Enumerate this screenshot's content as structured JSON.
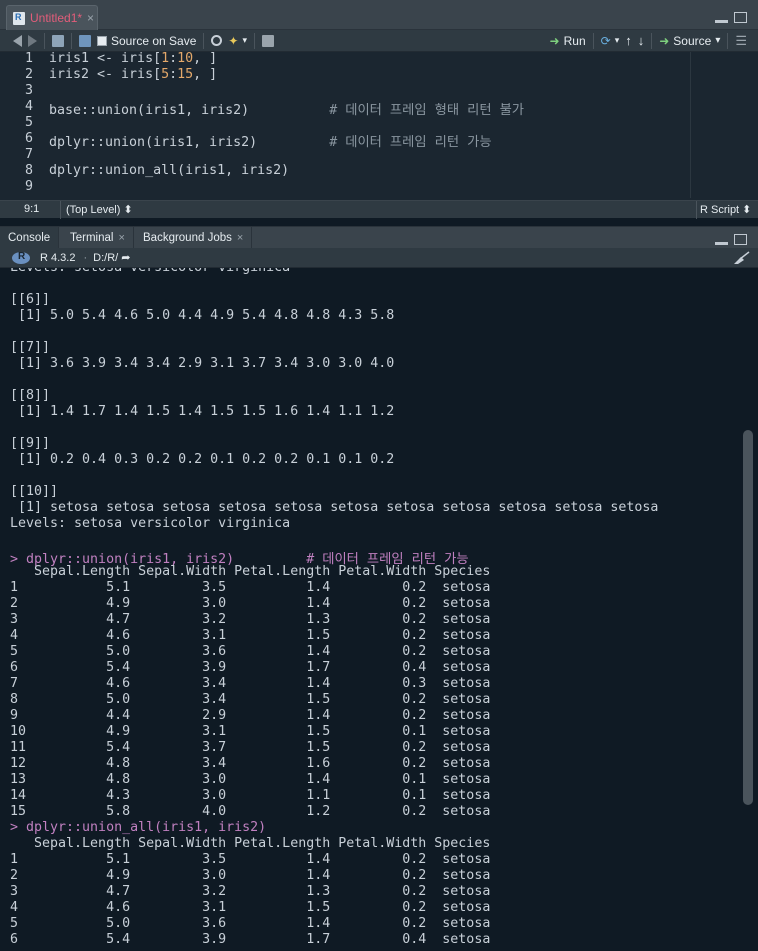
{
  "editor": {
    "tab_label": "Untitled1*",
    "tab_close": "×",
    "toolbar": {
      "source_on_save": "Source on Save",
      "run": "Run",
      "source": "Source",
      "source_menu": "▾"
    },
    "lines": [
      {
        "num": "1",
        "parts": [
          {
            "t": "iris1 <- iris[",
            "c": ""
          },
          {
            "t": "1",
            "c": "num"
          },
          {
            "t": ":",
            "c": ""
          },
          {
            "t": "10",
            "c": "num"
          },
          {
            "t": ", ]",
            "c": ""
          }
        ]
      },
      {
        "num": "2",
        "parts": [
          {
            "t": "iris2 <- iris[",
            "c": ""
          },
          {
            "t": "5",
            "c": "num"
          },
          {
            "t": ":",
            "c": ""
          },
          {
            "t": "15",
            "c": "num"
          },
          {
            "t": ", ]",
            "c": ""
          }
        ]
      },
      {
        "num": "3",
        "parts": []
      },
      {
        "num": "4",
        "parts": [
          {
            "t": "base::union(iris1, iris2)          ",
            "c": ""
          },
          {
            "t": "# 데이터 프레임 형태 리턴 불가",
            "c": "com"
          }
        ]
      },
      {
        "num": "5",
        "parts": []
      },
      {
        "num": "6",
        "parts": [
          {
            "t": "dplyr::union(iris1, iris2)         ",
            "c": ""
          },
          {
            "t": "# 데이터 프레임 리턴 가능",
            "c": "com"
          }
        ]
      },
      {
        "num": "7",
        "parts": []
      },
      {
        "num": "8",
        "parts": [
          {
            "t": "dplyr::union_all(iris1, iris2)",
            "c": ""
          }
        ]
      },
      {
        "num": "9",
        "parts": []
      }
    ],
    "status": {
      "position": "9:1",
      "scope": "(Top Level) ⬍",
      "file_type": "R Script ⬍"
    }
  },
  "console": {
    "tabs": [
      "Console",
      "Terminal",
      "Background Jobs"
    ],
    "tab_close": "×",
    "r_version": "R 4.3.2",
    "working_dir": "D:/R/ ➦",
    "lines": [
      {
        "t": "Levels: setosa versicolor virginica",
        "k": "out"
      },
      {
        "t": "",
        "k": "out"
      },
      {
        "t": "[[6]]",
        "k": "out"
      },
      {
        "t": " [1] 5.0 5.4 4.6 5.0 4.4 4.9 5.4 4.8 4.8 4.3 5.8",
        "k": "out"
      },
      {
        "t": "",
        "k": "out"
      },
      {
        "t": "[[7]]",
        "k": "out"
      },
      {
        "t": " [1] 3.6 3.9 3.4 3.4 2.9 3.1 3.7 3.4 3.0 3.0 4.0",
        "k": "out"
      },
      {
        "t": "",
        "k": "out"
      },
      {
        "t": "[[8]]",
        "k": "out"
      },
      {
        "t": " [1] 1.4 1.7 1.4 1.5 1.4 1.5 1.5 1.6 1.4 1.1 1.2",
        "k": "out"
      },
      {
        "t": "",
        "k": "out"
      },
      {
        "t": "[[9]]",
        "k": "out"
      },
      {
        "t": " [1] 0.2 0.4 0.3 0.2 0.2 0.1 0.2 0.2 0.1 0.1 0.2",
        "k": "out"
      },
      {
        "t": "",
        "k": "out"
      },
      {
        "t": "[[10]]",
        "k": "out"
      },
      {
        "t": " [1] setosa setosa setosa setosa setosa setosa setosa setosa setosa setosa setosa",
        "k": "out"
      },
      {
        "t": "Levels: setosa versicolor virginica",
        "k": "out"
      },
      {
        "t": "",
        "k": "out"
      },
      {
        "t": "> dplyr::union(iris1, iris2)         # 데이터 프레임 리턴 가능",
        "k": "cmd"
      },
      {
        "t": "   Sepal.Length Sepal.Width Petal.Length Petal.Width Species",
        "k": "out"
      },
      {
        "t": "1           5.1         3.5          1.4         0.2  setosa",
        "k": "out"
      },
      {
        "t": "2           4.9         3.0          1.4         0.2  setosa",
        "k": "out"
      },
      {
        "t": "3           4.7         3.2          1.3         0.2  setosa",
        "k": "out"
      },
      {
        "t": "4           4.6         3.1          1.5         0.2  setosa",
        "k": "out"
      },
      {
        "t": "5           5.0         3.6          1.4         0.2  setosa",
        "k": "out"
      },
      {
        "t": "6           5.4         3.9          1.7         0.4  setosa",
        "k": "out"
      },
      {
        "t": "7           4.6         3.4          1.4         0.3  setosa",
        "k": "out"
      },
      {
        "t": "8           5.0         3.4          1.5         0.2  setosa",
        "k": "out"
      },
      {
        "t": "9           4.4         2.9          1.4         0.2  setosa",
        "k": "out"
      },
      {
        "t": "10          4.9         3.1          1.5         0.1  setosa",
        "k": "out"
      },
      {
        "t": "11          5.4         3.7          1.5         0.2  setosa",
        "k": "out"
      },
      {
        "t": "12          4.8         3.4          1.6         0.2  setosa",
        "k": "out"
      },
      {
        "t": "13          4.8         3.0          1.4         0.1  setosa",
        "k": "out"
      },
      {
        "t": "14          4.3         3.0          1.1         0.1  setosa",
        "k": "out"
      },
      {
        "t": "15          5.8         4.0          1.2         0.2  setosa",
        "k": "out"
      },
      {
        "t": "> dplyr::union_all(iris1, iris2)",
        "k": "cmd"
      },
      {
        "t": "   Sepal.Length Sepal.Width Petal.Length Petal.Width Species",
        "k": "out"
      },
      {
        "t": "1           5.1         3.5          1.4         0.2  setosa",
        "k": "out"
      },
      {
        "t": "2           4.9         3.0          1.4         0.2  setosa",
        "k": "out"
      },
      {
        "t": "3           4.7         3.2          1.3         0.2  setosa",
        "k": "out"
      },
      {
        "t": "4           4.6         3.1          1.5         0.2  setosa",
        "k": "out"
      },
      {
        "t": "5           5.0         3.6          1.4         0.2  setosa",
        "k": "out"
      },
      {
        "t": "6           5.4         3.9          1.7         0.4  setosa",
        "k": "out"
      }
    ]
  },
  "colors": {
    "comment": "#8a96a0",
    "number": "#e3a86a",
    "command": "#c080c0",
    "text": "#c8d0d8"
  }
}
